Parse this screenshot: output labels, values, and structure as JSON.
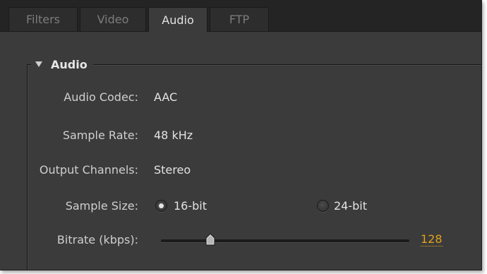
{
  "tabs": [
    {
      "label": "Filters",
      "active": false
    },
    {
      "label": "Video",
      "active": false
    },
    {
      "label": "Audio",
      "active": true
    },
    {
      "label": "FTP",
      "active": false
    }
  ],
  "section": {
    "title": "Audio",
    "expanded": true,
    "icon": "disclosure-triangle-down-icon"
  },
  "fields": {
    "audio_codec": {
      "label": "Audio Codec:",
      "value": "AAC"
    },
    "sample_rate": {
      "label": "Sample Rate:",
      "value": "48 kHz"
    },
    "output_channels": {
      "label": "Output Channels:",
      "value": "Stereo"
    },
    "sample_size": {
      "label": "Sample Size:",
      "options": [
        "16-bit",
        "24-bit"
      ],
      "selected": "16-bit"
    },
    "bitrate": {
      "label": "Bitrate (kbps):",
      "value": "128",
      "slider_fraction": 0.2
    }
  },
  "colors": {
    "panel_background": "#3b3b3b",
    "tab_bar": "#242424",
    "hot_text_value": "#e0a21c",
    "text": "#e3e3e3"
  }
}
